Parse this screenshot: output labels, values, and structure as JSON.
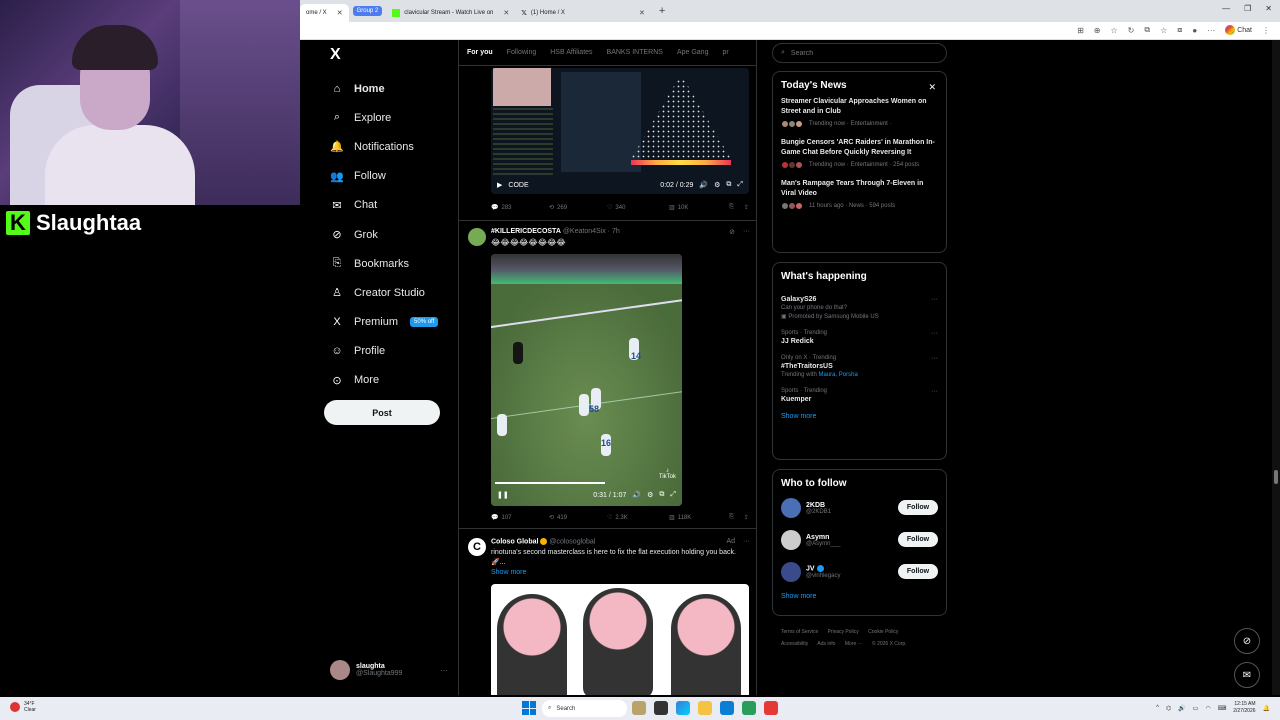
{
  "stream": {
    "brand_letter": "K",
    "streamer_name": "Slaughtaa"
  },
  "browser": {
    "tabs": [
      {
        "title": "ome / X",
        "active": true
      },
      {
        "title": "clavicular Stream - Watch Live on",
        "group": "Group 2"
      },
      {
        "title": "(1) Home / X"
      }
    ],
    "new_tab": "+",
    "chat_label": "Chat"
  },
  "sidebar": {
    "logo": "X",
    "items": [
      {
        "icon": "⌂",
        "label": "Home",
        "bold": true
      },
      {
        "icon": "⌕",
        "label": "Explore"
      },
      {
        "icon": "🔔",
        "label": "Notifications"
      },
      {
        "icon": "👥",
        "label": "Follow"
      },
      {
        "icon": "✉",
        "label": "Chat"
      },
      {
        "icon": "⊘",
        "label": "Grok"
      },
      {
        "icon": "⎘",
        "label": "Bookmarks"
      },
      {
        "icon": "♙",
        "label": "Creator Studio"
      },
      {
        "icon": "X",
        "label": "Premium",
        "badge": "50% off"
      },
      {
        "icon": "☺",
        "label": "Profile"
      },
      {
        "icon": "⊙",
        "label": "More"
      }
    ],
    "post_label": "Post",
    "account": {
      "name": "slaughta",
      "handle": "@Slaughta999",
      "menu": "···"
    }
  },
  "feed": {
    "tabs": [
      "For you",
      "Following",
      "HSB Affiliates",
      "BANKS INTERNS",
      "Ape Gang",
      "pr"
    ],
    "post1": {
      "video_label": "CODE",
      "time": "0:02 / 0:29",
      "replies": "283",
      "reposts": "269",
      "likes": "340",
      "views": "10K"
    },
    "post2": {
      "name": "#KILLERICDECOSTA",
      "handle": "@Keaton4Six · 7h",
      "text": "😂😂😂😂😂😂😂😂",
      "time": "0:31 / 1:07",
      "tiktok": "TikTok",
      "jerseys": [
        "14",
        "58",
        "16"
      ],
      "replies": "107",
      "reposts": "419",
      "likes": "2.3K",
      "views": "118K"
    },
    "post3": {
      "name": "Coloso Global",
      "handle": "@colosoglobal",
      "ad": "Ad",
      "text": "rinotuna's second masterclass is here to fix the flat execution holding you back. 🚀...",
      "show_more": "Show more"
    }
  },
  "right": {
    "search_placeholder": "Search",
    "news": {
      "title": "Today's News",
      "items": [
        {
          "title": "Streamer Clavicular Approaches Women on Street and in Club",
          "meta": "Trending now · Entertainment ·"
        },
        {
          "title": "Bungie Censors 'ARC Raiders' in Marathon In-Game Chat Before Quickly Reversing It",
          "meta": "Trending now · Entertainment · 254 posts"
        },
        {
          "title": "Man's Rampage Tears Through 7-Eleven in Viral Video",
          "meta": "11 hours ago · News · 594 posts"
        }
      ]
    },
    "happening": {
      "title": "What's happening",
      "items": [
        {
          "ctx": "",
          "name": "GalaxyS26",
          "sub": "Can your phone do that?",
          "sub2": "Promoted by Samsung Mobile US"
        },
        {
          "ctx": "Sports · Trending",
          "name": "JJ Redick"
        },
        {
          "ctx": "Only on X · Trending",
          "name": "#TheTraitorsUS",
          "sub": "Trending with",
          "sub_links": "Maura, Porsha"
        },
        {
          "ctx": "Sports · Trending",
          "name": "Kuemper"
        }
      ],
      "show_more": "Show more"
    },
    "who": {
      "title": "Who to follow",
      "items": [
        {
          "name": "2KDB",
          "handle": "@2KDB1",
          "btn": "Follow"
        },
        {
          "name": "Asymn",
          "handle": "@Asymn___",
          "btn": "Follow"
        },
        {
          "name": "JV",
          "handle": "@vlnhlegacy",
          "btn": "Follow"
        }
      ],
      "show_more": "Show more"
    },
    "legal": [
      "Terms of Service",
      "Privacy Policy",
      "Cookie Policy",
      "Accessibility",
      "Ads info",
      "More ···",
      "© 2026 X Corp."
    ]
  },
  "taskbar": {
    "weather_temp": "34°F",
    "weather_desc": "Clear",
    "search": "Search",
    "time": "12:15 AM",
    "date": "2/27/2026"
  }
}
